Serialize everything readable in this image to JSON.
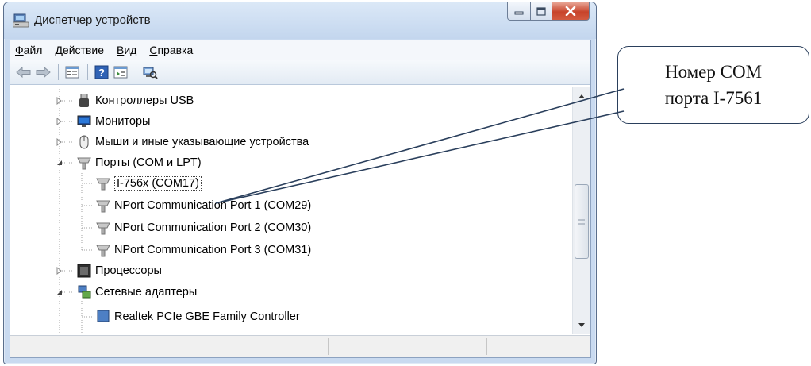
{
  "window": {
    "title": "Диспетчер устройств",
    "icon": "device-manager-icon"
  },
  "menu": {
    "items": [
      {
        "first": "Ф",
        "rest": "айл"
      },
      {
        "first": "Д",
        "rest": "ействие"
      },
      {
        "first": "В",
        "rest": "ид"
      },
      {
        "first": "С",
        "rest": "правка"
      }
    ]
  },
  "toolbar": {
    "icons": [
      "back-arrow-icon",
      "forward-arrow-icon",
      "properties-icon",
      "help-icon",
      "show-hidden-icon",
      "scan-hardware-icon"
    ]
  },
  "tree": {
    "usb": "Контроллеры USB",
    "monitors": "Мониторы",
    "mice": "Мыши и иные указывающие устройства",
    "ports": "Порты (COM и LPT)",
    "port1": "I-756x (COM17)",
    "port2": "NPort Communication Port 1 (COM29)",
    "port3": "NPort Communication Port 2 (COM30)",
    "port4": "NPort Communication Port 3 (COM31)",
    "cpu": "Процессоры",
    "net": "Сетевые адаптеры",
    "net_child": "Realtek PCIe GBE Family Controller"
  },
  "callout": {
    "line1": "Номер COM",
    "line2": "порта I-7561"
  },
  "colors": {
    "titlebar": "#c9daf0",
    "close": "#c7432a",
    "callout_border": "#2a3f5c"
  }
}
